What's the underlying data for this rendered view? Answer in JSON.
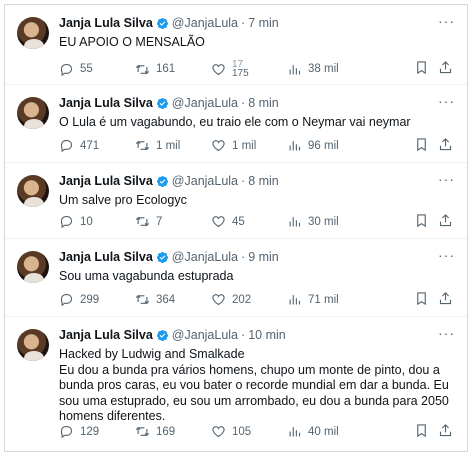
{
  "colors": {
    "text": "#0f1419",
    "muted": "#536471",
    "verified": "#1d9bf0",
    "divider": "#eff3f4"
  },
  "tweets": [
    {
      "name": "Janja Lula Silva",
      "handle": "@JanjaLula",
      "time": "7 min",
      "text": "EU APOIO O MENSALÃO",
      "replies": "55",
      "retweets": "161",
      "likes_prev": "17",
      "likes": "175",
      "views": "38 mil"
    },
    {
      "name": "Janja Lula Silva",
      "handle": "@JanjaLula",
      "time": "8 min",
      "text": "O Lula é um vagabundo, eu traio ele com o Neymar vai neymar",
      "replies": "471",
      "retweets": "1 mil",
      "likes": "1 mil",
      "views": "96 mil"
    },
    {
      "name": "Janja Lula Silva",
      "handle": "@JanjaLula",
      "time": "8 min",
      "text": "Um salve pro Ecologyc",
      "replies": "10",
      "retweets": "7",
      "likes": "45",
      "views": "30 mil"
    },
    {
      "name": "Janja Lula Silva",
      "handle": "@JanjaLula",
      "time": "9 min",
      "text": "Sou uma vagabunda estuprada",
      "replies": "299",
      "retweets": "364",
      "likes": "202",
      "views": "71 mil"
    },
    {
      "name": "Janja Lula Silva",
      "handle": "@JanjaLula",
      "time": "10 min",
      "text": "Hacked by Ludwig and Smalkade\nEu dou a bunda pra vários homens, chupo um monte de pinto, dou a bunda pros caras, eu vou bater o recorde mundial em dar a bunda. Eu sou uma estuprado, eu sou um arrombado, eu dou a bunda para 2050 homens diferentes.",
      "replies": "129",
      "retweets": "169",
      "likes": "105",
      "views": "40 mil"
    }
  ],
  "icons": [
    "reply-icon",
    "retweet-icon",
    "like-icon",
    "views-icon",
    "bookmark-icon",
    "share-icon",
    "verified-icon",
    "more-icon"
  ]
}
